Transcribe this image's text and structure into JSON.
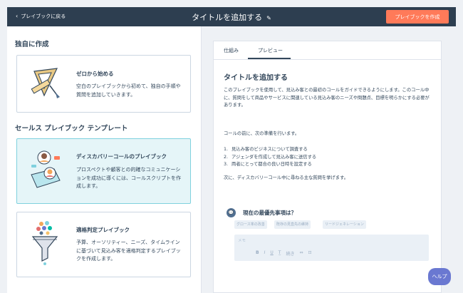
{
  "topbar": {
    "back_label": "プレイブックに戻る",
    "title": "タイトルを追加する",
    "create_label": "プレイブックを作成"
  },
  "left": {
    "section1": "独自に作成",
    "section2": "セールス プレイブック テンプレート",
    "cards": [
      {
        "title": "ゼロから始める",
        "desc": "空白のプレイブックから初めて、独自の手順や質問を追加していきます。"
      },
      {
        "title": "ディスカバリーコールのプレイブック",
        "desc": "プロスペクトや顧客との的確なコミュニケーションを成功に導くには、コールスクリプトを作成します。"
      },
      {
        "title": "適格判定プレイブック",
        "desc": "予算、オーソリティー、ニーズ、タイムラインに基づいて見込み客を適格判定するプレイブックを作成します。"
      }
    ]
  },
  "preview": {
    "tabs": [
      "仕組み",
      "プレビュー"
    ],
    "doc_title": "タイトルを追加する",
    "intro": "このプレイブックを使用して、見込み客との最初のコールをガイドできるようにします。このコール中に、質問をして商品やサービスに関連している見込み客のニーズや問題点、目標を明らかにする必要があります。",
    "prep": "コールの前に、次の準備を行います。",
    "steps": [
      {
        "num": "1.",
        "text": "見込み客のビジネスについて調査する"
      },
      {
        "num": "2.",
        "text": "アジェンダを作成して見込み客に送信する"
      },
      {
        "num": "3.",
        "text": "両者にとって都合の良い日時を設定する"
      }
    ],
    "next": "次に、ディスカバリーコール中に尋ねる主な質問を挙げます。",
    "question": "現在の最優先事項は？",
    "chips": [
      "グロース率の改善",
      "既存の見直先の維持",
      "リードジェネレーション"
    ],
    "memo_placeholder": "メモ",
    "toolbar": [
      "B",
      "I",
      "U",
      "T̲",
      "続き",
      "⇔",
      "⊡"
    ]
  },
  "help_label": "ヘルプ",
  "colors": {
    "topbar": "#2d3e50",
    "accent": "#ff7a59",
    "selected_bg": "#e5f5f8",
    "selected_border": "#7fd1de",
    "help": "#6a78d1"
  }
}
